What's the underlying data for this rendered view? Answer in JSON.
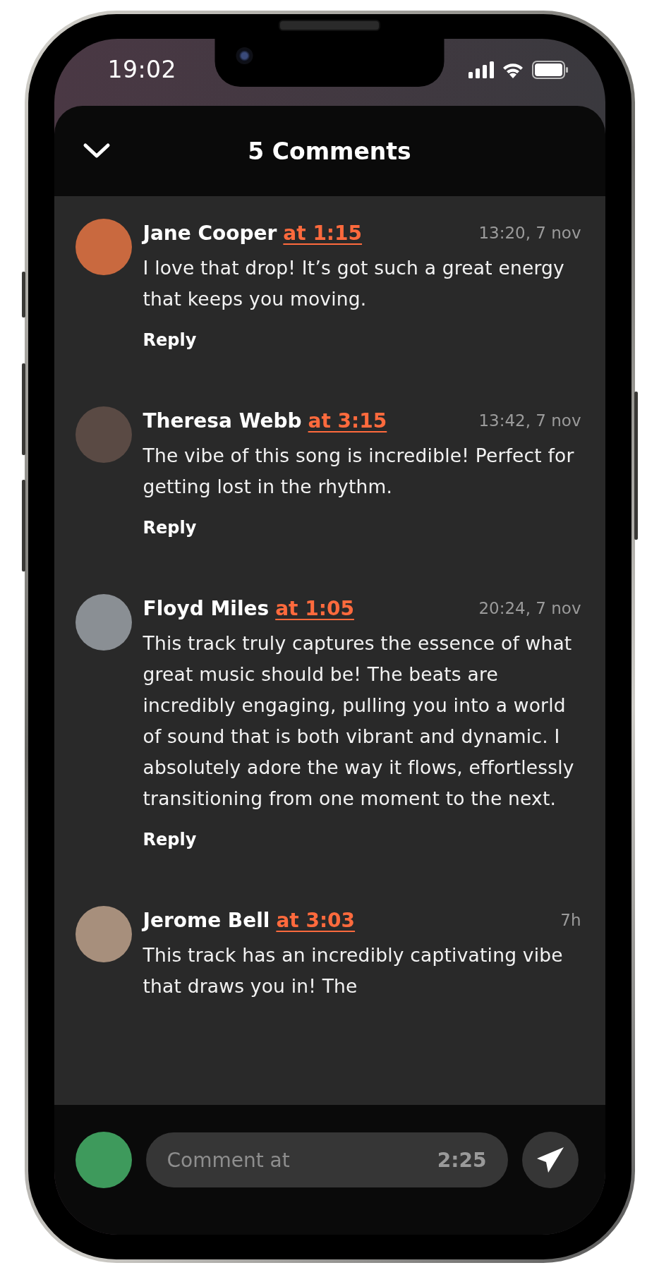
{
  "status_bar": {
    "time": "19:02"
  },
  "header": {
    "title": "5 Comments"
  },
  "comments": [
    {
      "author": "Jane Cooper",
      "timestamp_link": "at 1:15",
      "time": "13:20, 7 nov",
      "text": "I love that drop! It’s got such a great energy that keeps you moving.",
      "reply": "Reply"
    },
    {
      "author": "Theresa Webb",
      "timestamp_link": "at 3:15",
      "time": "13:42, 7 nov",
      "text": "The vibe of this song is incredible! Perfect for getting lost in the rhythm.",
      "reply": "Reply"
    },
    {
      "author": "Floyd Miles",
      "timestamp_link": "at 1:05",
      "time": "20:24, 7 nov",
      "text": "This track truly captures the essence of what great music should be! The beats are incredibly engaging, pulling you into a world of sound that is both vibrant and dynamic. I absolutely adore the way it flows, effortlessly transitioning from one moment to the next.",
      "reply": "Reply"
    },
    {
      "author": "Jerome Bell",
      "timestamp_link": "at 3:03",
      "time": "7h",
      "text": "This track has an incredibly captivating vibe that draws you in! The"
    }
  ],
  "composer": {
    "placeholder": "Comment at",
    "timestamp": "2:25"
  }
}
